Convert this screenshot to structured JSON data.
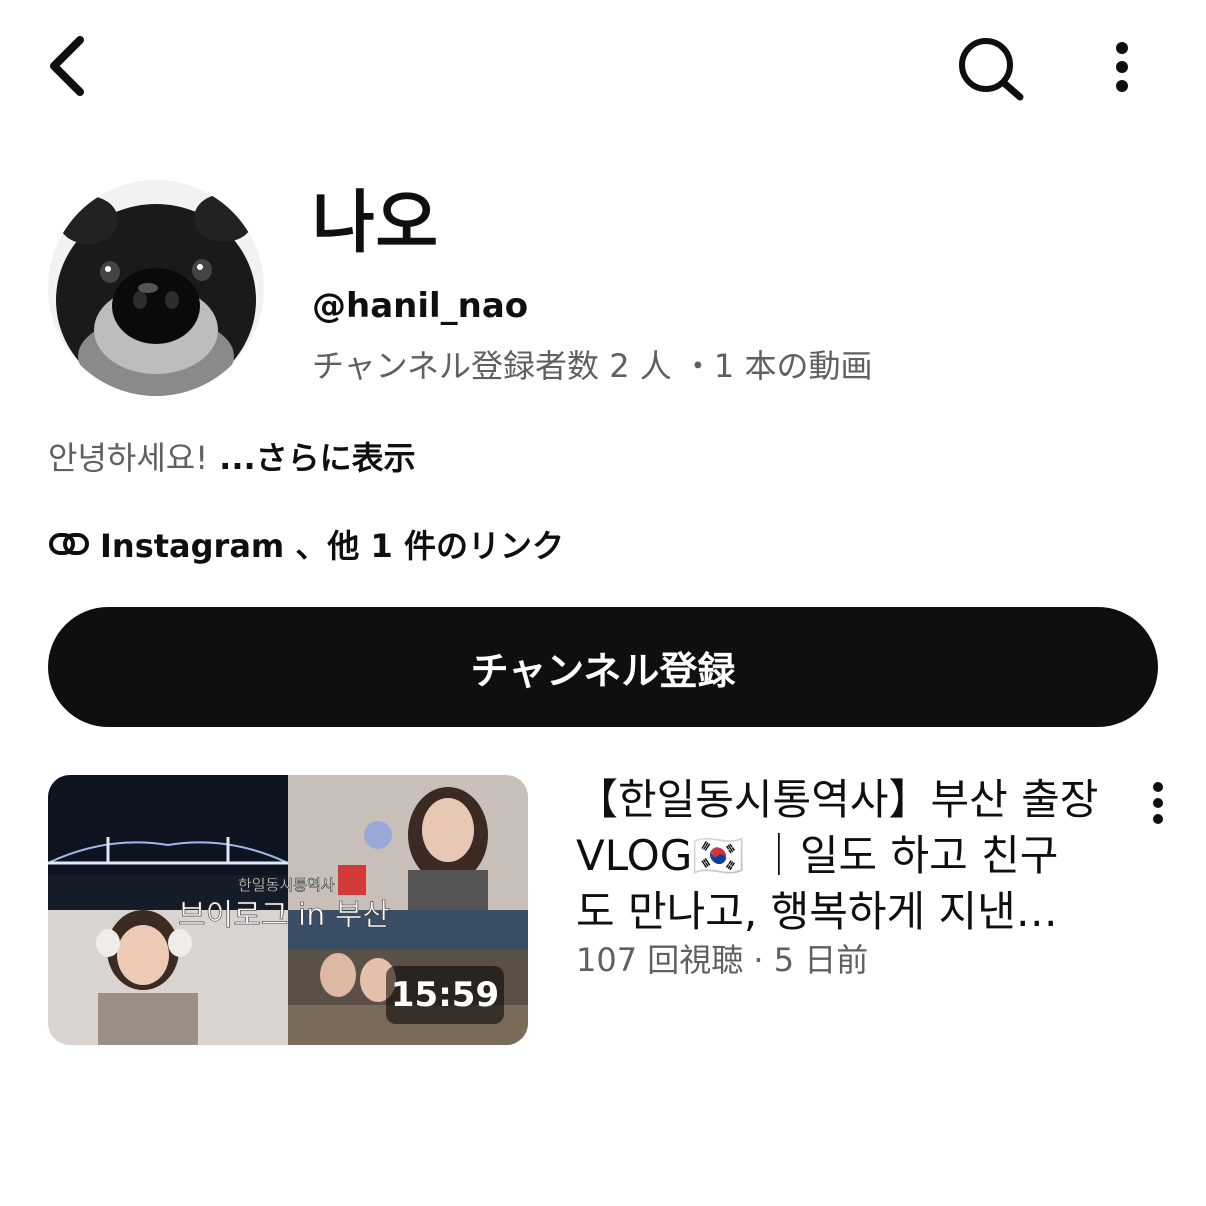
{
  "topbar": {
    "back_icon": "chevron-left-icon",
    "search_icon": "search-icon",
    "more_icon": "more-vert-icon"
  },
  "channel": {
    "name": "나오",
    "handle": "@hanil_nao",
    "stats": "チャンネル登録者数 2 人 ・1 本の動画",
    "description": "안녕하세요!",
    "show_more": " ...さらに表示",
    "links": "Instagram 、他 1 件のリンク",
    "subscribe_label": "チャンネル登録"
  },
  "video": {
    "title_lines": [
      "【한일동시통역사】부산 출장",
      "VLOG🇰🇷 ｜일도 하고 친구",
      "도 만나고, 행복하게 지낸…"
    ],
    "meta": "107 回視聴 · 5 日前",
    "duration": "15:59",
    "thumb_overlay_small": "한일동시통역사",
    "thumb_overlay_large": "브이로그 in 부산"
  }
}
